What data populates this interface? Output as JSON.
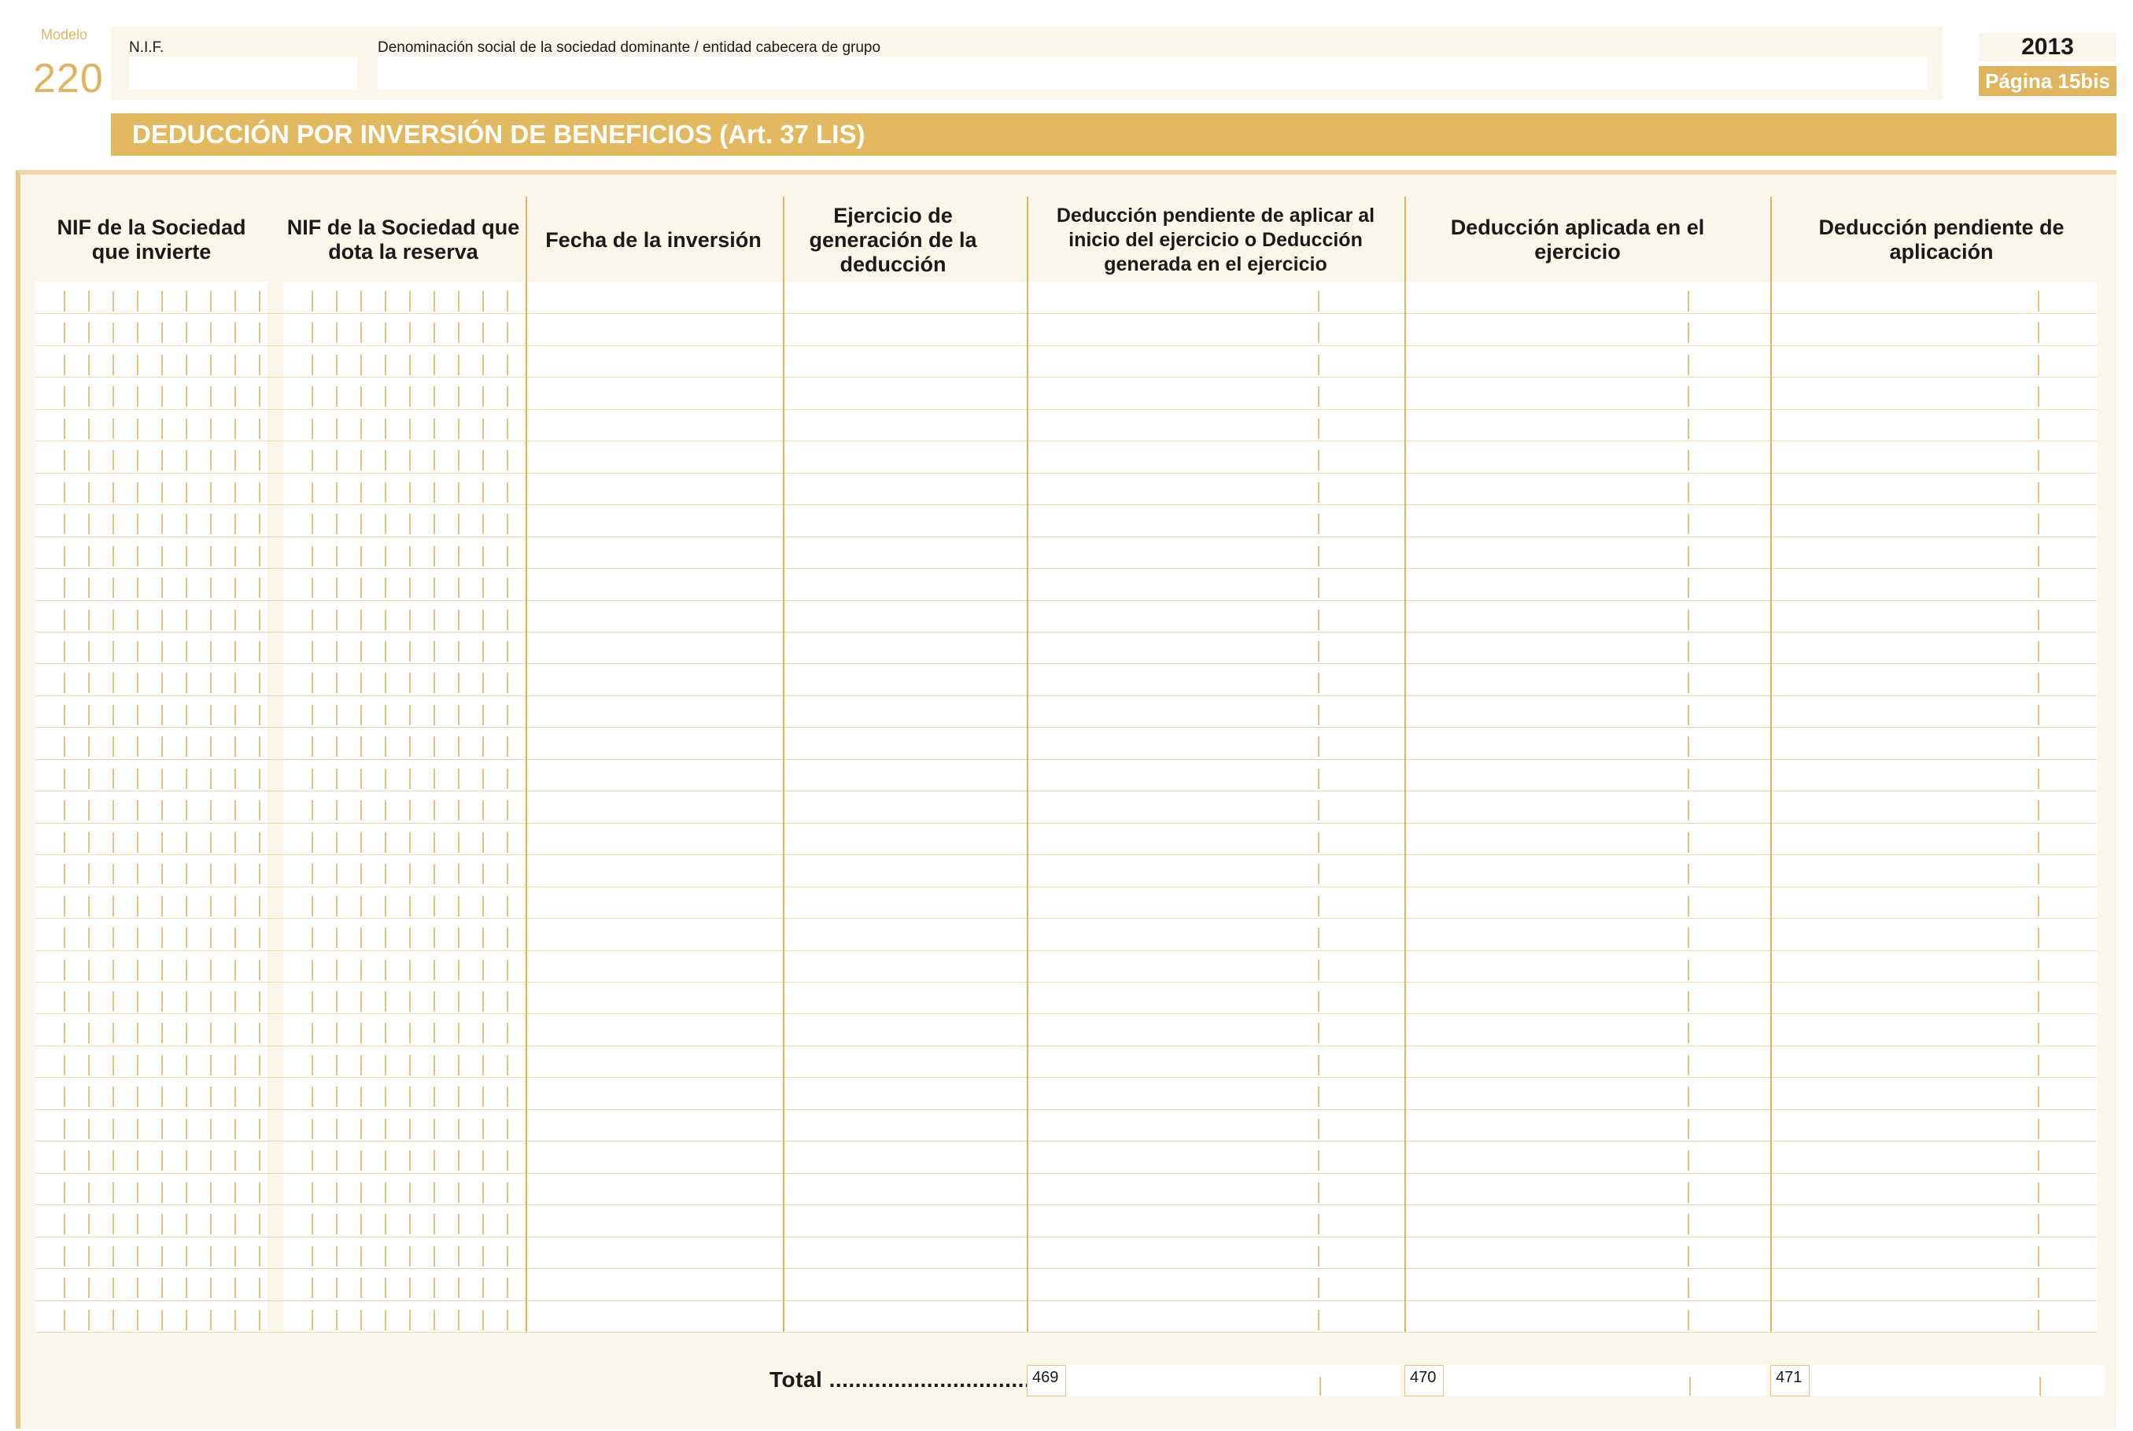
{
  "form": {
    "modelo_label": "Modelo",
    "modelo_number": "220",
    "nif_label": "N.I.F.",
    "nif_value": "",
    "denominacion_label": "Denominación social de la sociedad dominante / entidad cabecera de grupo",
    "denominacion_value": "",
    "year": "2013",
    "page": "Página 15bis",
    "section_title": "DEDUCCIÓN POR INVERSIÓN DE BENEFICIOS (Art. 37 LIS)"
  },
  "table": {
    "headers": [
      "NIF de la Sociedad que invierte",
      "NIF de la Sociedad que dota la reserva",
      "Fecha de la inversión",
      "Ejercicio de generación de la deducción",
      "Deducción pendiente de aplicar al inicio del ejercicio o Deducción generada en el ejercicio",
      "Deducción aplicada en el ejercicio",
      "Deducción pendiente de aplicación"
    ],
    "row_count": 33,
    "total_label": "Total ...............................",
    "total_codes": [
      "469",
      "470",
      "471"
    ],
    "total_values": [
      "",
      "",
      ""
    ]
  },
  "colors": {
    "accent": "#e3b960",
    "panel": "#fbf6ea",
    "line": "#e0b45c"
  }
}
